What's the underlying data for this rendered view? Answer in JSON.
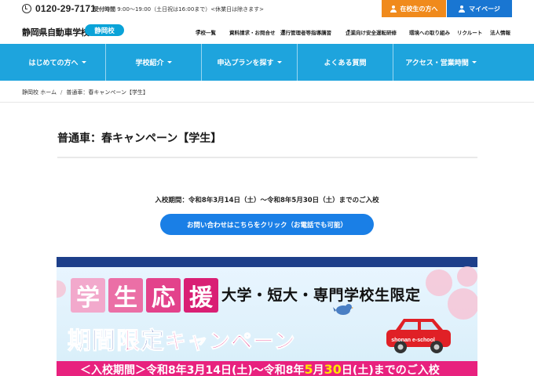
{
  "topbar": {
    "phone": "0120-29-7171",
    "hours_label": "受付時間",
    "hours": "9:00〜19:00（土日祝は16:00まで）<休業日は除きます>",
    "student_button": "在校生の方へ",
    "mypage_button": "マイページ",
    "colors": {
      "student": "#f08a1c",
      "mypage": "#1976d2"
    }
  },
  "header": {
    "logo": "静岡県自動車学校",
    "school_badge": "静岡校",
    "subnav": [
      {
        "label": "学校一覧",
        "dropdown": true
      },
      {
        "label": "資料請求・お問合せ",
        "dropdown": false
      },
      {
        "label": "運行管理者等指導講習",
        "dropdown": true
      },
      {
        "label": "企業向け安全運転研修",
        "dropdown": true
      },
      {
        "label": "環境への取り組み",
        "dropdown": false
      },
      {
        "label": "リクルート",
        "dropdown": false
      },
      {
        "label": "法人情報",
        "dropdown": false
      }
    ]
  },
  "mainnav": {
    "items": [
      {
        "label": "はじめての方へ",
        "dropdown": true
      },
      {
        "label": "学校紹介",
        "dropdown": true
      },
      {
        "label": "申込プランを探す",
        "dropdown": true
      },
      {
        "label": "よくある質問",
        "dropdown": false
      },
      {
        "label": "アクセス・営業時間",
        "dropdown": true
      }
    ],
    "color": "#1ea4dd"
  },
  "breadcrumb": {
    "home": "静岡校 ホーム",
    "separator": "/",
    "current": "普通車：春キャンペーン【学生】"
  },
  "content": {
    "title": "普通車：春キャンペーン【学生】",
    "period": "入校期間：令和8年3月14日（土）〜令和8年5月30日（土）までのご入校",
    "contact_button": "お問い合わせはこちらをクリック（お電話でも可能）"
  },
  "banner": {
    "tiles": [
      "学",
      "生",
      "応",
      "援"
    ],
    "tile_colors": [
      "#f2a9cc",
      "#eb6fa6",
      "#e3428b",
      "#d91f74"
    ],
    "slogan": "大学・短大・専門学校生限定",
    "campaign_prefix_1": "期間",
    "campaign_highlight": "限",
    "campaign_prefix_2": "定",
    "campaign_suffix": "キャンペーン",
    "car_label": "shonan e-school",
    "period_prefix": "＜入校期間＞令和8年3月14日",
    "period_dow_1": "(土)",
    "period_mid": "〜令和8年",
    "period_hl_month": "5",
    "period_hl_day": "30",
    "period_suffix": "日",
    "period_dow_2": "(土)",
    "period_end": "までのご入校"
  }
}
